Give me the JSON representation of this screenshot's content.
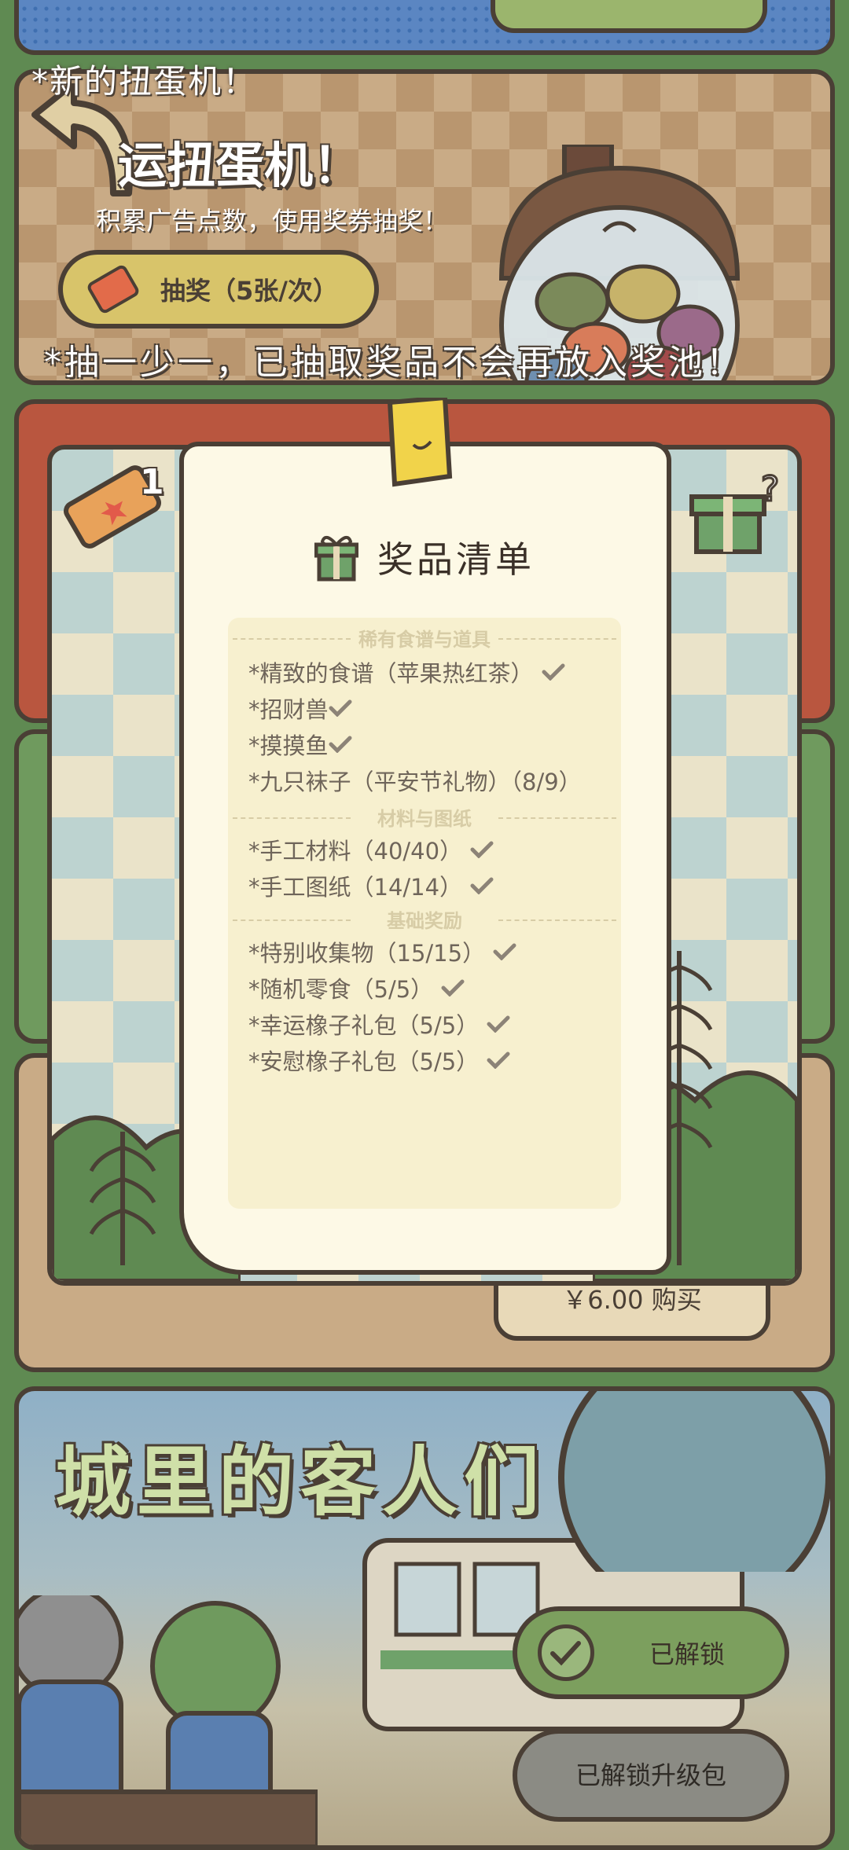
{
  "gacha": {
    "new_note": "*新的扭蛋机！",
    "title": "运扭蛋机！",
    "subtitle": "积累广告点数，使用奖券抽奖！",
    "draw_button": "抽奖（5张/次）",
    "note": "*抽一少一，已抽取奖品不会再放入奖池！"
  },
  "popup": {
    "ticket_count": "1",
    "list_title": "奖品清单",
    "sections": [
      {
        "title": "稀有食谱与道具",
        "items": [
          {
            "label": "*精致的食谱（苹果热红茶）",
            "checked": true
          },
          {
            "label": "*招财兽",
            "checked": true
          },
          {
            "label": "*摸摸鱼",
            "checked": true
          },
          {
            "label": "*九只袜子（平安节礼物）（8/9）",
            "checked": false
          }
        ]
      },
      {
        "title": "材料与图纸",
        "items": [
          {
            "label": "*手工材料（40/40）",
            "checked": true
          },
          {
            "label": "*手工图纸（14/14）",
            "checked": true
          }
        ]
      },
      {
        "title": "基础奖励",
        "items": [
          {
            "label": "*特别收集物（15/15）",
            "checked": true
          },
          {
            "label": "*随机零食（5/5）",
            "checked": true
          },
          {
            "label": "*幸运橡子礼包（5/5）",
            "checked": true
          },
          {
            "label": "*安慰橡子礼包（5/5）",
            "checked": true
          }
        ]
      }
    ]
  },
  "behind": {
    "buy_button": "￥6.00 购买"
  },
  "city": {
    "title": "城里的客人们",
    "unlocked_button": "已解锁",
    "upgrade_button": "已解锁升级包"
  },
  "colors": {
    "outline": "#4a3f35",
    "background_green": "#5f8a52",
    "paper": "#fdf9e6",
    "check": "#8c8377"
  },
  "icons": [
    "back-arrow-icon",
    "ticket-icon",
    "gift-icon",
    "gift-question-icon",
    "check-icon",
    "tape-icon"
  ]
}
